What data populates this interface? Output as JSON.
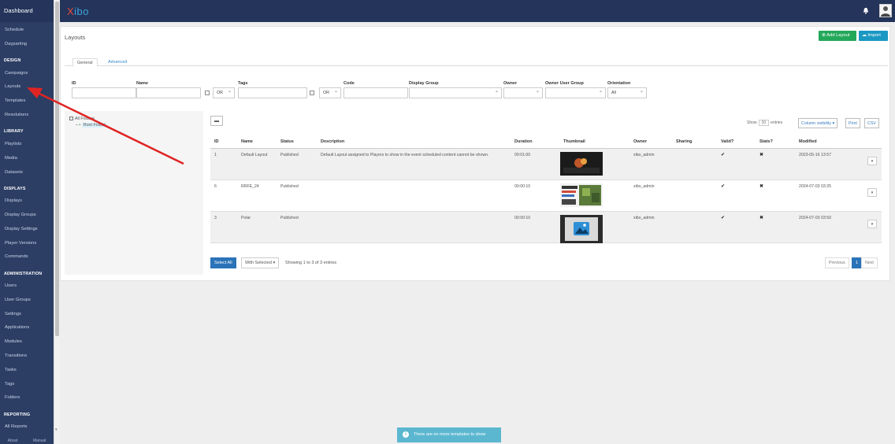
{
  "sidebar": {
    "brand": "Dashboard",
    "items": [
      {
        "label": "Schedule"
      },
      {
        "label": "Dayparting"
      },
      {
        "label": "Campaigns"
      },
      {
        "label": "Layouts"
      },
      {
        "label": "Templates"
      },
      {
        "label": "Resolutions"
      },
      {
        "label": "Playlists"
      },
      {
        "label": "Media"
      },
      {
        "label": "Datasets"
      },
      {
        "label": "Displays"
      },
      {
        "label": "Display Groups"
      },
      {
        "label": "Display Settings"
      },
      {
        "label": "Player Versions"
      },
      {
        "label": "Commands"
      },
      {
        "label": "Users"
      },
      {
        "label": "User Groups"
      },
      {
        "label": "Settings"
      },
      {
        "label": "Applications"
      },
      {
        "label": "Modules"
      },
      {
        "label": "Transitions"
      },
      {
        "label": "Tasks"
      },
      {
        "label": "Tags"
      },
      {
        "label": "Folders"
      },
      {
        "label": "All Reports"
      }
    ],
    "sections": [
      "DESIGN",
      "LIBRARY",
      "DISPLAYS",
      "ADMINISTRATION",
      "REPORTING"
    ],
    "footer": {
      "about": "About",
      "manual": "Manual"
    }
  },
  "topbar": {
    "logo_main": "ibo",
    "logo_x": "X",
    "bell_icon": "bell-icon",
    "avatar_icon": "user-avatar"
  },
  "page": {
    "title": "Layouts",
    "add_button": "Add Layout",
    "import_button": "Import",
    "tabs": {
      "general": "General",
      "advanced": "Advanced"
    }
  },
  "filters": {
    "id_label": "ID",
    "name_label": "Name",
    "tags_label": "Tags",
    "code_label": "Code",
    "display_group_label": "Display Group",
    "owner_label": "Owner",
    "owner_user_group_label": "Owner User Group",
    "orientation_label": "Orientation",
    "logic_name": "OR",
    "logic_tags": "OR",
    "orientation_value": "All"
  },
  "tree": {
    "all_folders": "All Folders",
    "root": "Root Folder"
  },
  "table": {
    "show_label": "Show",
    "show_count": "10",
    "entries_label": "entries",
    "column_visibility": "Column visibility",
    "print": "Print",
    "csv": "CSV",
    "headers": [
      "ID",
      "Name",
      "Status",
      "Description",
      "Duration",
      "Thumbnail",
      "Owner",
      "Sharing",
      "Valid?",
      "Stats?",
      "Modified"
    ],
    "rows": [
      {
        "id": "1",
        "name": "Default Layout",
        "status": "Published",
        "description": "Default Layout assigned to Players to show in the event scheduled content cannot be shown.",
        "duration": "00:01:00",
        "owner": "xibo_admin",
        "sharing": "",
        "valid": "✔",
        "stats": "✖",
        "modified": "2023-05-16 13:57",
        "action": "▾"
      },
      {
        "id": "6",
        "name": "RRFE_24",
        "status": "Published",
        "description": "",
        "duration": "00:00:10",
        "owner": "xibo_admin",
        "sharing": "",
        "valid": "✔",
        "stats": "✖",
        "modified": "2024-07-03 03:25",
        "action": "▾"
      },
      {
        "id": "3",
        "name": "Polar",
        "status": "Published",
        "description": "",
        "duration": "00:00:10",
        "owner": "xibo_admin",
        "sharing": "",
        "valid": "✔",
        "stats": "✖",
        "modified": "2024-07-03 03:50",
        "action": "▾"
      }
    ],
    "select_all": "Select All",
    "with_selected": "With Selected",
    "showing": "Showing 1 to 3 of 3 entries",
    "previous": "Previous",
    "page": "1",
    "next": "Next"
  },
  "toast": {
    "text": "There are no more templates to show"
  },
  "colors": {
    "sidebar": "#2c3e64",
    "topbar": "#24345a",
    "add": "#23a85a",
    "import": "#1a98c3",
    "primary": "#2a73b8",
    "toast": "#5bb7d0",
    "annotation_arrow": "#e02424"
  }
}
